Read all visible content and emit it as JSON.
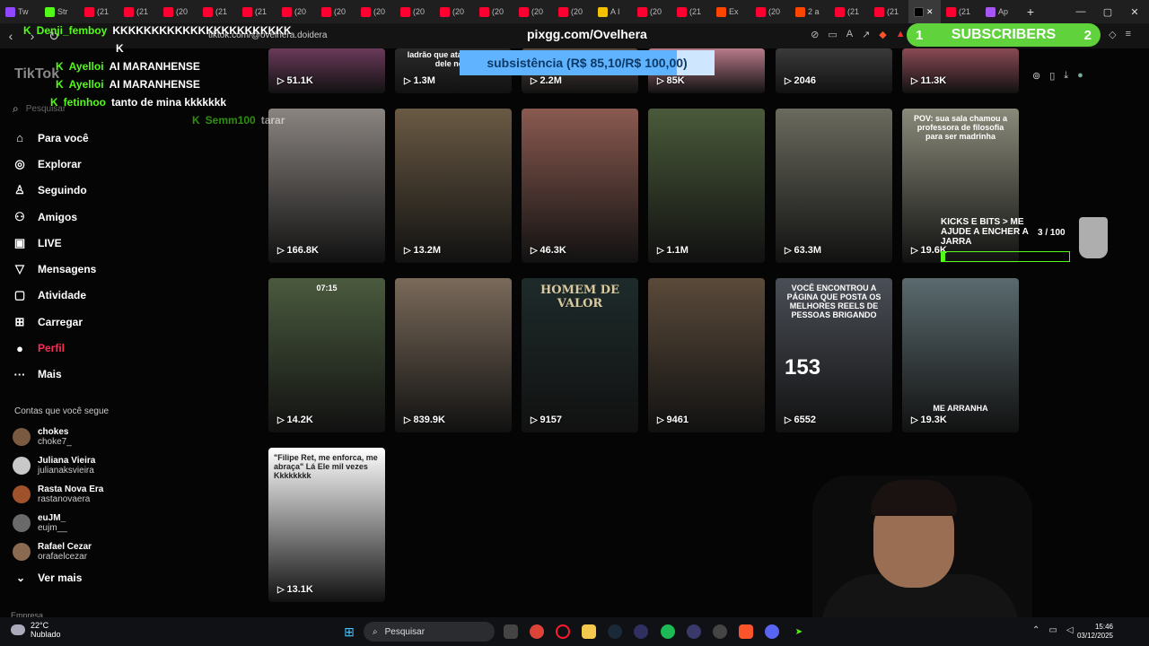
{
  "browser": {
    "tabs": [
      {
        "label": "Tw",
        "color": "#9146ff"
      },
      {
        "label": "Str",
        "color": "#53fc18"
      },
      {
        "label": "(21",
        "color": "#ff0033"
      },
      {
        "label": "(21",
        "color": "#ff0033"
      },
      {
        "label": "(20",
        "color": "#ff0033"
      },
      {
        "label": "(21",
        "color": "#ff0033"
      },
      {
        "label": "(21",
        "color": "#ff0033"
      },
      {
        "label": "(20",
        "color": "#ff0033"
      },
      {
        "label": "(20",
        "color": "#ff0033"
      },
      {
        "label": "(20",
        "color": "#ff0033"
      },
      {
        "label": "(20",
        "color": "#ff0033"
      },
      {
        "label": "(20",
        "color": "#ff0033"
      },
      {
        "label": "(20",
        "color": "#ff0033"
      },
      {
        "label": "(20",
        "color": "#ff0033"
      },
      {
        "label": "(20",
        "color": "#ff0033"
      },
      {
        "label": "A I",
        "color": "#f2c200"
      },
      {
        "label": "(20",
        "color": "#ff0033"
      },
      {
        "label": "(21",
        "color": "#ff0033"
      },
      {
        "label": "Ex",
        "color": "#ff4500"
      },
      {
        "label": "(20",
        "color": "#ff0033"
      },
      {
        "label": "2 a",
        "color": "#ff4500"
      },
      {
        "label": "(21",
        "color": "#ff0033"
      },
      {
        "label": "(21",
        "color": "#ff0033"
      }
    ],
    "active_tab_close": "✕",
    "tabs_after": [
      {
        "label": "(21",
        "color": "#ff0033"
      },
      {
        "label": "Ap",
        "color": "#a855f7"
      }
    ],
    "new_tab": "+",
    "url": "tiktok.com/@ovelhera.doidera"
  },
  "stream": {
    "chat": [
      {
        "user": "Denji_femboy",
        "message": "KKKKKKKKKKKKKKKKKKKKKKK"
      },
      {
        "user": "",
        "message": "K"
      },
      {
        "user": "Ayelloi",
        "message": "AI MARANHENSE"
      },
      {
        "user": "Ayelloi",
        "message": "AI MARANHENSE"
      },
      {
        "user": "fetinhoo",
        "message": "tanto de mina kkkkkkk"
      },
      {
        "user": "Semm100",
        "message": "tarar"
      }
    ],
    "pix_title": "pixgg.com/Ovelhera",
    "goal": {
      "text": "subsistência (R$ 85,10/R$ 100,00)",
      "progress": 0.851
    },
    "subscribers": {
      "count": "1",
      "label": "SUBSCRIBERS",
      "goal": "2"
    },
    "jar": {
      "title": "KICKS E BITS > ME AJUDE A ENCHER A JARRA",
      "count": "3  / 100",
      "progress": 0.03
    }
  },
  "sidebar": {
    "logo": "TikTok",
    "search_placeholder": "Pesquisar",
    "nav": [
      {
        "label": "Para você",
        "icon": "home-icon",
        "glyph": "⌂"
      },
      {
        "label": "Explorar",
        "icon": "compass-icon",
        "glyph": "◎"
      },
      {
        "label": "Seguindo",
        "icon": "person-add-icon",
        "glyph": "♙"
      },
      {
        "label": "Amigos",
        "icon": "friends-icon",
        "glyph": "⚇"
      },
      {
        "label": "LIVE",
        "icon": "live-tv-icon",
        "glyph": "▣"
      },
      {
        "label": "Mensagens",
        "icon": "paper-plane-icon",
        "glyph": "▽"
      },
      {
        "label": "Atividade",
        "icon": "activity-icon",
        "glyph": "▢"
      },
      {
        "label": "Carregar",
        "icon": "upload-plus-icon",
        "glyph": "⊞"
      },
      {
        "label": "Perfil",
        "icon": "profile-avatar-icon",
        "glyph": "●"
      },
      {
        "label": "Mais",
        "icon": "more-dots-icon",
        "glyph": "···"
      }
    ],
    "following_title": "Contas que você segue",
    "following": [
      {
        "name": "chokes",
        "handle": "choke7_",
        "color": "#7a5a40"
      },
      {
        "name": "Juliana Vieira",
        "handle": "julianaksvieira",
        "color": "#c8c8c8"
      },
      {
        "name": "Rasta Nova Era",
        "handle": "rastanovaera",
        "color": "#a0522d"
      },
      {
        "name": "euJM_",
        "handle": "eujm__",
        "color": "#6a6a6a"
      },
      {
        "name": "Rafael Cezar",
        "handle": "orafaelcezar",
        "color": "#8a6a50"
      }
    ],
    "see_more": "Ver mais",
    "company": "Empresa"
  },
  "grid": {
    "row0": [
      {
        "views": "51.1K",
        "bg": "#6a3a5a"
      },
      {
        "views": "1.3M",
        "bg": "#2a2a2a",
        "caption": "ladrão que ataco família dele no R"
      },
      {
        "views": "2.2M",
        "bg": "#5a4a44"
      },
      {
        "views": "85K",
        "bg": "#b87a8a"
      },
      {
        "views": "2046",
        "bg": "#3a3a3a"
      },
      {
        "views": "11.3K",
        "bg": "#8a4a54"
      }
    ],
    "row1": [
      {
        "views": "166.8K",
        "bg": "#8a8480"
      },
      {
        "views": "13.2M",
        "bg": "#6a5a44"
      },
      {
        "views": "46.3K",
        "bg": "#8a5a50"
      },
      {
        "views": "1.1M",
        "bg": "#4a5a3a"
      },
      {
        "views": "63.3M",
        "bg": "#6a6a5e"
      },
      {
        "views": "19.6K",
        "bg": "#8a8a7a",
        "caption": "POV: sua sala chamou a professora de filosofia para ser madrinha"
      }
    ],
    "row2": [
      {
        "views": "14.2K",
        "bg": "#4a5a3e",
        "caption": "07:15"
      },
      {
        "views": "839.9K",
        "bg": "#7a6a5a"
      },
      {
        "views": "9157",
        "bg": "#1e2a2a",
        "caption": "HOMEM DE VALOR"
      },
      {
        "views": "9461",
        "bg": "#5a4a3a"
      },
      {
        "views": "6552",
        "bg": "#4a4e56",
        "caption": "VOCÊ ENCONTROU A PÁGINA QUE POSTA OS MELHORES REELS DE PESSOAS BRIGANDO"
      },
      {
        "views": "19.3K",
        "bg": "#5a6a6e",
        "caption": "ME ARRANHA"
      }
    ],
    "row3": [
      {
        "views": "13.1K",
        "bg": "#ffffff",
        "caption": "\"Filipe Ret, me enforca, me abraça\" Lá Ele mil vezes Kkkkkkkk"
      }
    ],
    "kick_twitch_count": "153"
  },
  "taskbar": {
    "weather_temp": "22°C",
    "weather_desc": "Nublado",
    "search": "Pesquisar",
    "time": "15:46",
    "date": "03/12/2025"
  }
}
